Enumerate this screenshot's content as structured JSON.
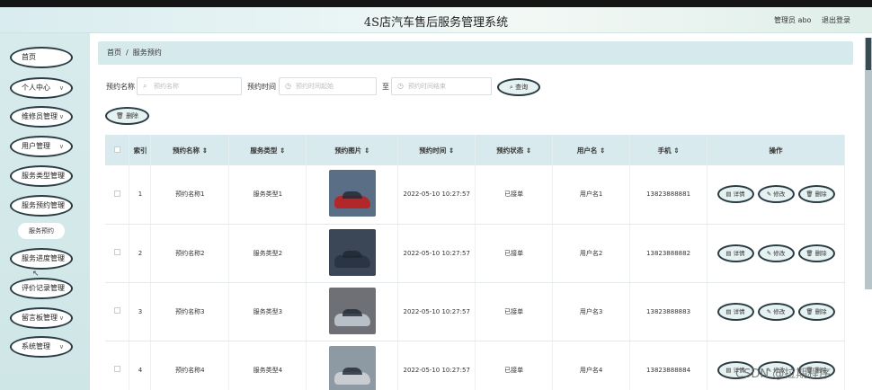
{
  "header": {
    "title": "4S店汽车售后服务管理系统",
    "user": "管理员 abo",
    "logout": "退出登录"
  },
  "sidebar": {
    "items": [
      {
        "label": "首页",
        "chevron": false
      },
      {
        "label": "个人中心",
        "chevron": true
      },
      {
        "label": "维修员管理",
        "chevron": true
      },
      {
        "label": "用户管理",
        "chevron": true
      },
      {
        "label": "服务类型管理",
        "chevron": true
      },
      {
        "label": "服务预约管理",
        "chevron": true
      },
      {
        "label": "服务进度管理",
        "chevron": true
      },
      {
        "label": "评价记录管理",
        "chevron": true
      },
      {
        "label": "留言板管理",
        "chevron": true
      },
      {
        "label": "系统管理",
        "chevron": true
      }
    ],
    "sub_item": "服务预约"
  },
  "breadcrumb": {
    "home": "首页",
    "sep": "/",
    "current": "服务预约"
  },
  "search": {
    "name_label": "预约名称",
    "name_placeholder": "预约名称",
    "time_label": "预约时间",
    "start_placeholder": "预约时间起始",
    "to_label": "至",
    "end_placeholder": "预约时间结束",
    "query_button": "查询",
    "delete_button": "删除"
  },
  "table": {
    "headers": [
      "索引",
      "预约名称",
      "服务类型",
      "预约图片",
      "预约时间",
      "预约状态",
      "用户名",
      "手机",
      "操作"
    ],
    "sort_mark": "⇕",
    "actions": {
      "detail": "详情",
      "edit": "修改",
      "delete": "删除"
    },
    "rows": [
      {
        "index": "1",
        "name": "预约名称1",
        "type": "服务类型1",
        "time": "2022-05-10 10:27:57",
        "status": "已接单",
        "user": "用户名1",
        "phone": "13823888881",
        "car_color": "#b3262a",
        "bg": "#5a6e86"
      },
      {
        "index": "2",
        "name": "预约名称2",
        "type": "服务类型2",
        "time": "2022-05-10 10:27:57",
        "status": "已接单",
        "user": "用户名2",
        "phone": "13823888882",
        "car_color": "#2a3442",
        "bg": "#3b4656"
      },
      {
        "index": "3",
        "name": "预约名称3",
        "type": "服务类型3",
        "time": "2022-05-10 10:27:57",
        "status": "已接单",
        "user": "用户名3",
        "phone": "13823888883",
        "car_color": "#b9bfc6",
        "bg": "#6f7076"
      },
      {
        "index": "4",
        "name": "预约名称4",
        "type": "服务类型4",
        "time": "2022-05-10 10:27:57",
        "status": "已接单",
        "user": "用户名4",
        "phone": "13823888884",
        "car_color": "#c9ccd0",
        "bg": "#8e9aa3"
      }
    ]
  },
  "watermark": "CSDN @拉期程序"
}
